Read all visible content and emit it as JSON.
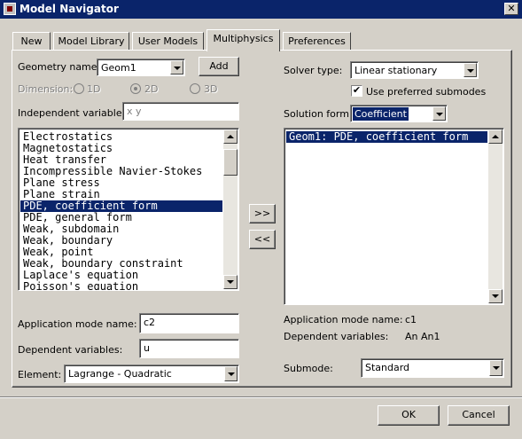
{
  "window": {
    "title": "Model Navigator",
    "close_label": "✕"
  },
  "tabs": [
    {
      "label": "New",
      "active": false
    },
    {
      "label": "Model Library",
      "active": false
    },
    {
      "label": "User Models",
      "active": false
    },
    {
      "label": "Multiphysics",
      "active": true
    },
    {
      "label": "Preferences",
      "active": false
    }
  ],
  "left": {
    "geometry_name_label": "Geometry name:",
    "geometry_name_value": "Geom1",
    "add_label": "Add",
    "dimension_label": "Dimension:",
    "dimension_options": [
      "1D",
      "2D",
      "3D"
    ],
    "dimension_selected": "2D",
    "independent_label": "Independent variables:",
    "independent_value": "x y",
    "app_modes": [
      "Electrostatics",
      "Magnetostatics",
      "Heat transfer",
      "Incompressible Navier-Stokes",
      "Plane stress",
      "Plane strain",
      "PDE, coefficient form",
      "PDE, general form",
      "Weak, subdomain",
      "Weak, boundary",
      "Weak, point",
      "Weak, boundary constraint",
      "Laplace's equation",
      "Poisson's equation"
    ],
    "app_modes_selected": "PDE, coefficient form",
    "app_mode_name_label": "Application mode name:",
    "app_mode_name_value": "c2",
    "dependent_label": "Dependent variables:",
    "dependent_value": "u",
    "element_label": "Element:",
    "element_value": "Lagrange - Quadratic"
  },
  "middle": {
    "add_arrow": ">>",
    "remove_arrow": "<<"
  },
  "right": {
    "solver_type_label": "Solver type:",
    "solver_type_value": "Linear stationary",
    "use_preferred_label": "Use preferred submodes",
    "use_preferred_checked": true,
    "solution_form_label": "Solution form:",
    "solution_form_value": "Coefficient",
    "model_items": [
      "Geom1: PDE, coefficient form"
    ],
    "app_mode_name_label": "Application mode name:",
    "app_mode_name_value": "c1",
    "dependent_label": "Dependent variables:",
    "dependent_value": "An An1",
    "submode_label": "Submode:",
    "submode_value": "Standard"
  },
  "footer": {
    "ok_label": "OK",
    "cancel_label": "Cancel"
  }
}
